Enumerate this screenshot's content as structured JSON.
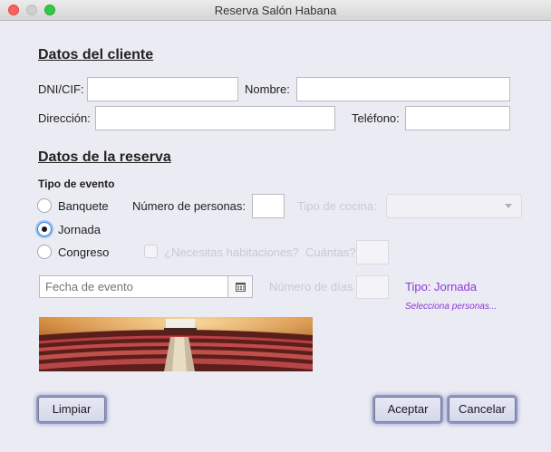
{
  "window": {
    "title": "Reserva Salón Habana"
  },
  "cliente": {
    "heading": "Datos del cliente",
    "dni_label": "DNI/CIF:",
    "dni_value": "",
    "nombre_label": "Nombre:",
    "nombre_value": "",
    "direccion_label": "Dirección:",
    "direccion_value": "",
    "telefono_label": "Teléfono:",
    "telefono_value": ""
  },
  "reserva": {
    "heading": "Datos de la reserva",
    "tipo_evento_label": "Tipo de evento",
    "options": [
      "Banquete",
      "Jornada",
      "Congreso"
    ],
    "selected": "Jornada",
    "num_personas_label": "Número de personas:",
    "num_personas_value": "",
    "tipo_cocina_label": "Tipo de cocina:",
    "tipo_cocina_value": "",
    "habitaciones_label": "¿Necesitas habitaciones?",
    "cuantas_label": "Cuántas?",
    "fecha_placeholder": "Fecha de evento",
    "num_dias_label": "Número de días",
    "tipo_status": "Tipo: Jornada",
    "hint": "Selecciona personas..."
  },
  "buttons": {
    "limpiar": "Limpiar",
    "aceptar": "Aceptar",
    "cancelar": "Cancelar"
  },
  "icons": {
    "calendar": "calendar-icon"
  },
  "colors": {
    "accent": "#8a38d8",
    "selected_radio": "#3b82e0",
    "button_glow": "#8f97c4"
  }
}
